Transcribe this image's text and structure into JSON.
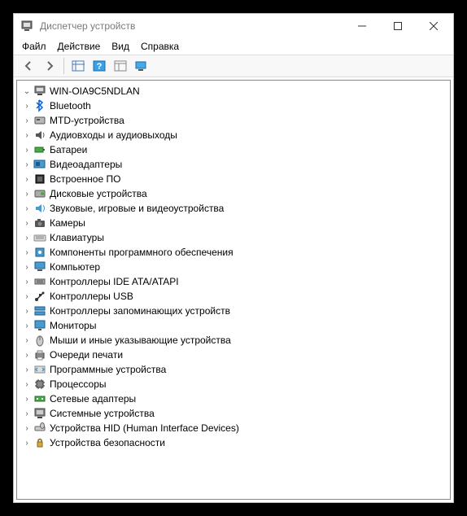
{
  "window": {
    "title": "Диспетчер устройств"
  },
  "menu": {
    "file": "Файл",
    "action": "Действие",
    "view": "Вид",
    "help": "Справка"
  },
  "root": {
    "name": "WIN-OIA9C5NDLAN"
  },
  "devices": [
    {
      "icon": "bluetooth",
      "label": "Bluetooth"
    },
    {
      "icon": "mtd",
      "label": "MTD-устройства"
    },
    {
      "icon": "audio",
      "label": "Аудиовходы и аудиовыходы"
    },
    {
      "icon": "battery",
      "label": "Батареи"
    },
    {
      "icon": "video",
      "label": "Видеоадаптеры"
    },
    {
      "icon": "firmware",
      "label": "Встроенное ПО"
    },
    {
      "icon": "disk",
      "label": "Дисковые устройства"
    },
    {
      "icon": "sound",
      "label": "Звуковые, игровые и видеоустройства"
    },
    {
      "icon": "camera",
      "label": "Камеры"
    },
    {
      "icon": "keyboard",
      "label": "Клавиатуры"
    },
    {
      "icon": "software",
      "label": "Компоненты программного обеспечения"
    },
    {
      "icon": "computer",
      "label": "Компьютер"
    },
    {
      "icon": "ide",
      "label": "Контроллеры IDE ATA/ATAPI"
    },
    {
      "icon": "usb",
      "label": "Контроллеры USB"
    },
    {
      "icon": "storage-ctrl",
      "label": "Контроллеры запоминающих устройств"
    },
    {
      "icon": "monitor",
      "label": "Мониторы"
    },
    {
      "icon": "mouse",
      "label": "Мыши и иные указывающие устройства"
    },
    {
      "icon": "printer",
      "label": "Очереди печати"
    },
    {
      "icon": "program-dev",
      "label": "Программные устройства"
    },
    {
      "icon": "cpu",
      "label": "Процессоры"
    },
    {
      "icon": "network",
      "label": "Сетевые адаптеры"
    },
    {
      "icon": "system-dev",
      "label": "Системные устройства"
    },
    {
      "icon": "hid",
      "label": "Устройства HID (Human Interface Devices)"
    },
    {
      "icon": "security",
      "label": "Устройства безопасности"
    }
  ]
}
